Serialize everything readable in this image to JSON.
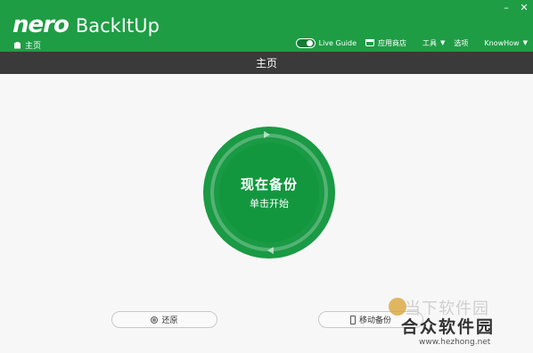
{
  "app": {
    "logo_brand": "nero",
    "logo_product": "BackItUp",
    "breadcrumb": "主页"
  },
  "window_controls": {
    "close": "✕"
  },
  "topnav": {
    "live_guide": "Live Guide",
    "app_store": "应用商店",
    "tools": "工具",
    "options": "选项",
    "knowhow": "KnowHow"
  },
  "titlebar": {
    "title": "主页"
  },
  "backup_circle": {
    "main": "现在备份",
    "sub": "单击开始"
  },
  "buttons": {
    "restore": "还原",
    "mobile_backup": "移动备份"
  },
  "watermark": {
    "line1": "当下软件园",
    "line2": "合众软件园",
    "url": "www.hezhong.net"
  },
  "colors": {
    "header_green": "#1f9d45",
    "titlebar_dark": "#3a3a3a",
    "circle_green": "#1a9a44"
  }
}
